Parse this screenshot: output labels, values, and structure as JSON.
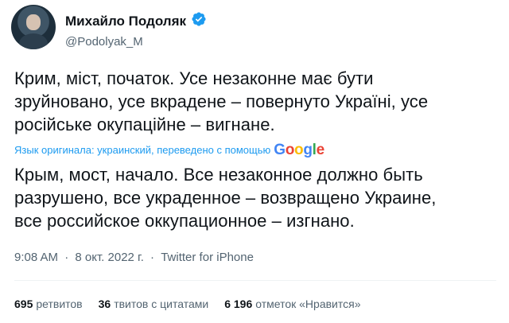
{
  "author": {
    "display_name": "Михайло Подоляк",
    "handle": "@Podolyak_M",
    "verified_badge_icon": "verified-badge-icon",
    "accent_color": "#1d9bf0"
  },
  "tweet": {
    "original_lines": [
      "Крим, міст, початок. Усе незаконне має бути",
      "зруйновано, усе вкрадене – повернуто Україні, усе",
      "російське окупаційне – вигнане."
    ],
    "translation_note": "Язык оригинала: украинский, переведено с помощью",
    "translation_provider": {
      "letters": [
        "G",
        "o",
        "o",
        "g",
        "l",
        "e"
      ],
      "colors": [
        "#4285f4",
        "#ea4335",
        "#fbbc05",
        "#4285f4",
        "#34a853",
        "#ea4335"
      ]
    },
    "translated_lines": [
      "Крым, мост, начало. Все незаконное должно быть",
      "разрушено, все украденное – возвращено Украине,",
      "все российское оккупационное – изгнано."
    ]
  },
  "meta": {
    "time": "9:08 AM",
    "separator": "·",
    "date": "8 окт. 2022 г.",
    "source": "Twitter for iPhone"
  },
  "stats": {
    "retweets_count": "695",
    "retweets_label": "ретвитов",
    "quotes_count": "36",
    "quotes_label": "твитов с цитатами",
    "likes_count": "6 196",
    "likes_label": "отметок «Нравится»"
  }
}
